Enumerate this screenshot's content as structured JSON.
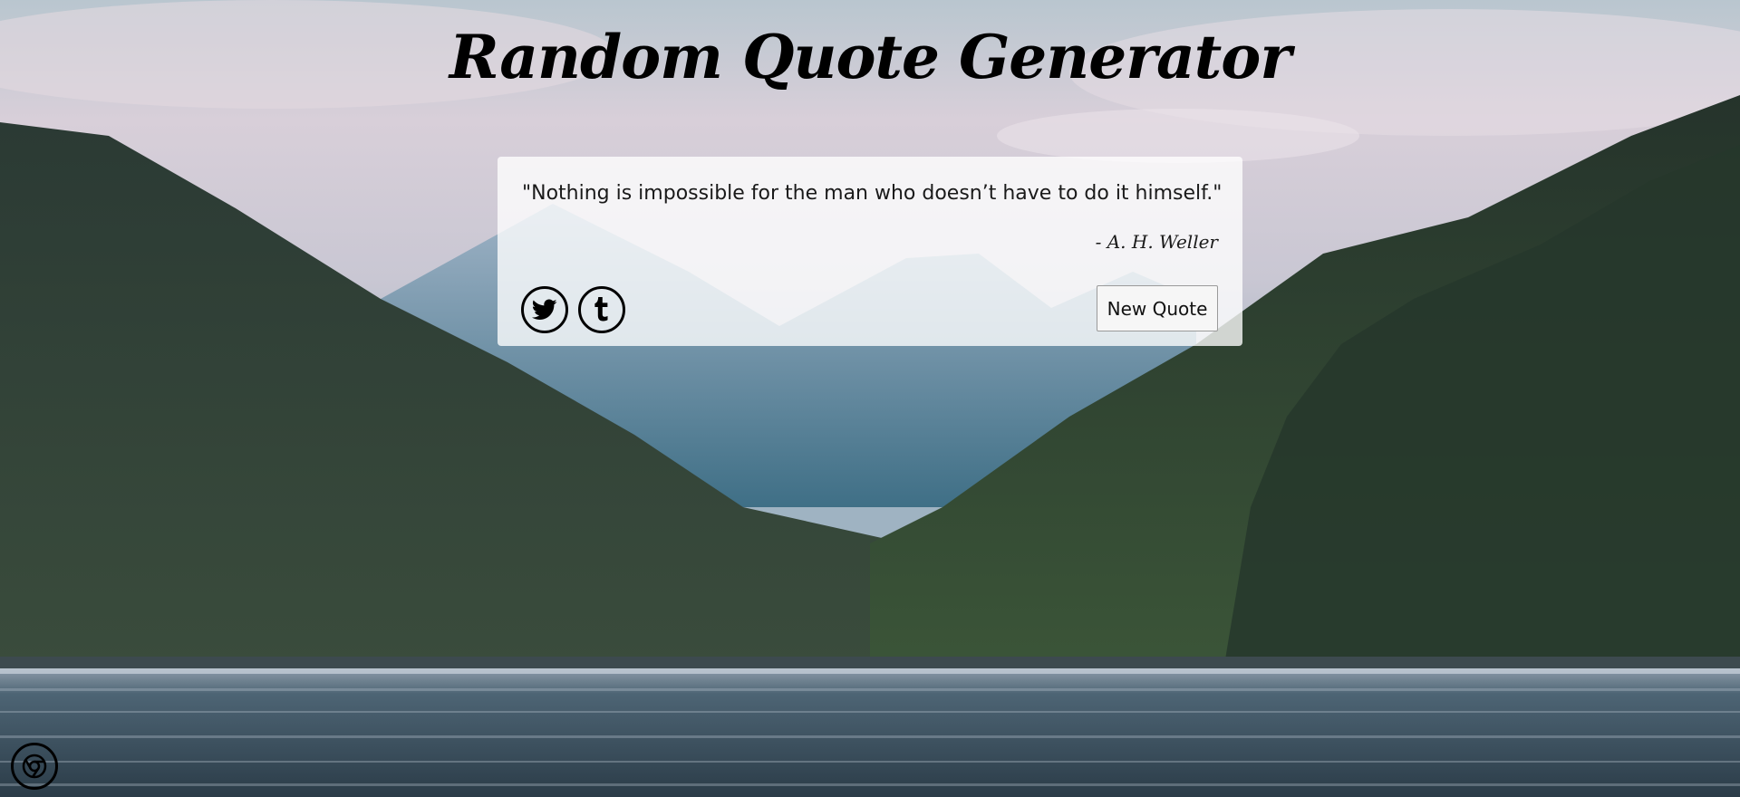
{
  "title": "Random Quote Generator",
  "quote": {
    "text": "\"Nothing is impossible for the man who doesn’t have to do it himself.\"",
    "author": "- A. H. Weller"
  },
  "buttons": {
    "new_quote": "New Quote",
    "twitter_icon": "twitter-bird-icon",
    "tumblr_icon": "tumblr-t-icon"
  },
  "corner": {
    "icon": "chrome-icon"
  },
  "colors": {
    "sky": "#d9cfd9",
    "mountain_far": "#6a8fa6",
    "forest": "#2f3d33",
    "water": "#34495a",
    "card_bg": "#f2f2f2",
    "text": "#111111"
  }
}
